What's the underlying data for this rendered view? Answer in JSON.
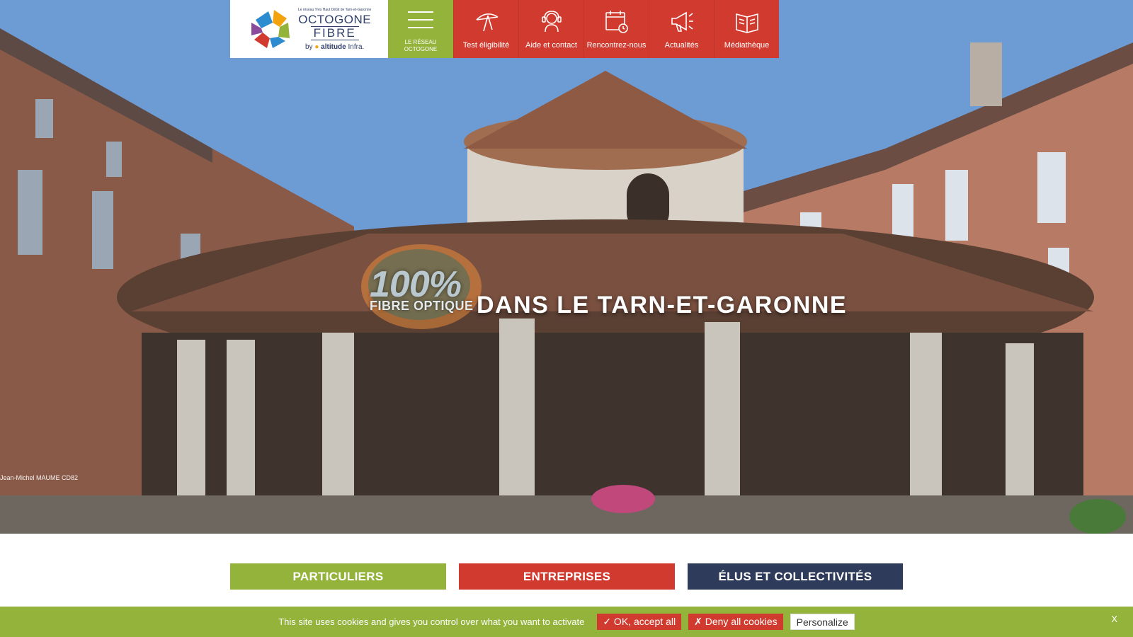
{
  "logo": {
    "tagline": "Le réseau Très Haut Débit de Tarn-et-Garonne",
    "word1": "OCTOGONE",
    "word2": "FIBRE",
    "by": "by",
    "partner": "altitude",
    "partner_suffix": "Infra."
  },
  "menu": {
    "label": "LE RÉSEAU OCTOGONE"
  },
  "nav": {
    "items": [
      {
        "label": "Test éligibilité",
        "icon": "antenna-icon"
      },
      {
        "label": "Aide et contact",
        "icon": "support-agent-icon"
      },
      {
        "label": "Rencontrez-nous",
        "icon": "calendar-clock-icon"
      },
      {
        "label": "Actualités",
        "icon": "megaphone-icon"
      },
      {
        "label": "Médiathèque",
        "icon": "book-icon"
      }
    ]
  },
  "hero": {
    "badge_num": "100%",
    "badge_sub": "FIBRE OPTIQUE",
    "headline": "DANS LE TARN-ET-GARONNE",
    "credit": "Jean-Michel MAUME CD82"
  },
  "categories": [
    {
      "label": "PARTICULIERS"
    },
    {
      "label": "ENTREPRISES"
    },
    {
      "label": "ÉLUS ET COLLECTIVITÉS"
    }
  ],
  "cookie": {
    "text": "This site uses cookies and gives you control over what you want to activate",
    "accept": "✓ OK, accept all",
    "deny": "✗ Deny all cookies",
    "personalize": "Personalize",
    "close": "X"
  },
  "colors": {
    "green": "#93b33a",
    "red": "#d13b2f",
    "navy": "#2f3b5b",
    "logo_blue": "#30406a"
  }
}
